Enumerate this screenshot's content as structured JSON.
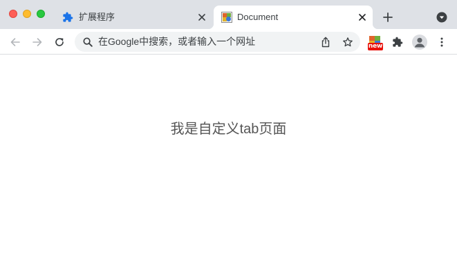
{
  "window": {
    "controls": [
      "close",
      "minimize",
      "zoom"
    ]
  },
  "tabs": [
    {
      "title": "扩展程序",
      "icon": "puzzle-icon",
      "active": false
    },
    {
      "title": "Document",
      "icon": "document-favicon",
      "active": true
    }
  ],
  "toolbar": {
    "omnibox_placeholder": "在Google中搜索，或者输入一个网址",
    "extension_badge": "new"
  },
  "page": {
    "heading": "我是自定义tab页面"
  },
  "colors": {
    "tabstrip": "#dee1e6",
    "accent_blue": "#1a73e8",
    "badge_red": "#e8120c",
    "icon_gray": "#5f6368"
  }
}
